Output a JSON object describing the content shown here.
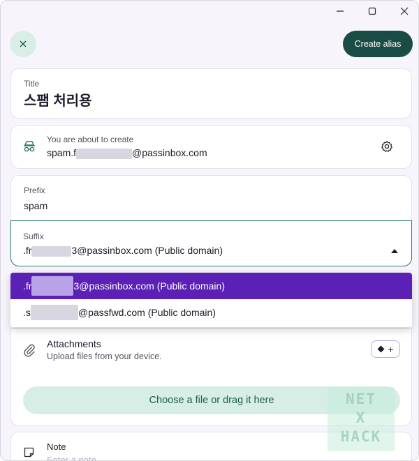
{
  "window": {
    "minimize": "—",
    "maximize": "☐",
    "close": "✕"
  },
  "header": {
    "close_icon": "✕",
    "create_alias_label": "Create alias"
  },
  "title_field": {
    "label": "Title",
    "value": "스팸 처리용"
  },
  "alias_preview": {
    "label": "You are about to create",
    "value_prefix": "spam.f",
    "value_suffix": "@passinbox.com",
    "icon": "incognito-icon",
    "settings_icon": "gear-icon"
  },
  "prefix_field": {
    "label": "Prefix",
    "value": "spam"
  },
  "suffix_field": {
    "label": "Suffix",
    "value_start": ".fr",
    "value_end": "3@passinbox.com (Public domain)"
  },
  "suffix_options": [
    {
      "start": ".fr",
      "end": "3@passinbox.com (Public domain)",
      "selected": true
    },
    {
      "start": ".s",
      "end": "@passfwd.com (Public domain)",
      "selected": false
    }
  ],
  "attachments": {
    "title": "Attachments",
    "subtitle": "Upload files from your device.",
    "drop_label": "Choose a file or drag it here",
    "badge_plus": "+"
  },
  "note": {
    "label": "Note",
    "placeholder": "Enter a note"
  },
  "watermark": {
    "line1": "NET",
    "line2": "X",
    "line3": "HACK"
  },
  "colors": {
    "accent": "#1a4b44",
    "selected_option": "#5b21b6",
    "mint": "#d8eee7"
  }
}
